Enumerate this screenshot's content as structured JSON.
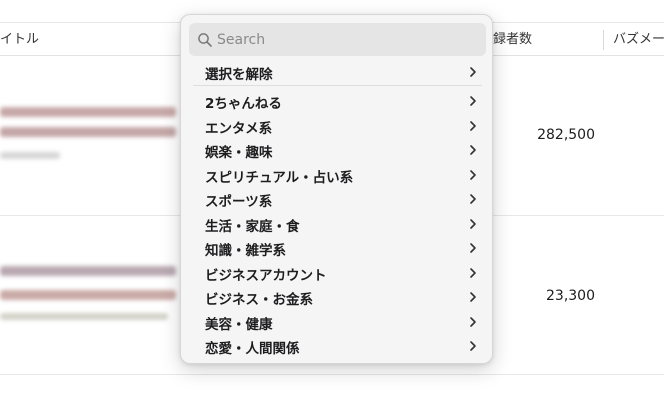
{
  "table": {
    "columns": [
      "イトル",
      "録者数",
      "バズメー"
    ],
    "rows": [
      {
        "subscribers": "282,500"
      },
      {
        "subscribers": "23,300"
      }
    ]
  },
  "menu": {
    "search_placeholder": "Search",
    "clear_label": "選択を解除",
    "categories": [
      "2ちゃんねる",
      "エンタメ系",
      "娯楽・趣味",
      "スピリチュアル・占い系",
      "スポーツ系",
      "生活・家庭・食",
      "知識・雑学系",
      "ビジネスアカウント",
      "ビジネス・お金系",
      "美容・健康",
      "恋愛・人間関係"
    ]
  },
  "icons": {
    "search": "search-icon",
    "chevron": "chevron-right-icon"
  }
}
